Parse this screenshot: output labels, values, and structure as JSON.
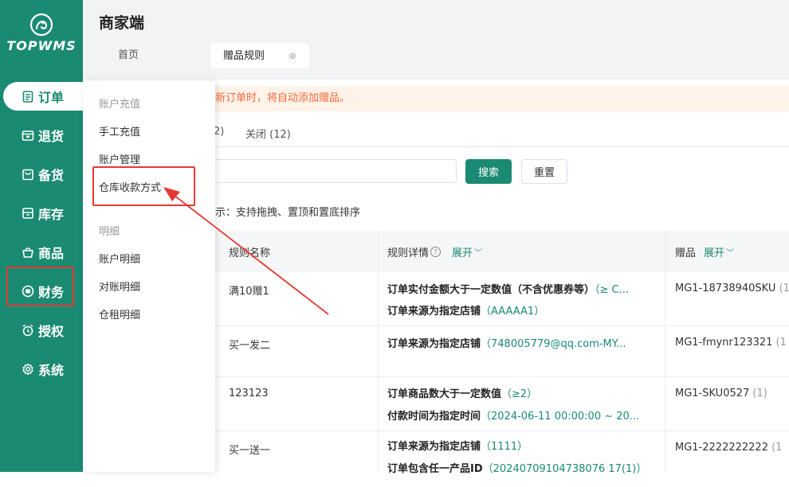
{
  "sidebar": {
    "logo_text": "TOPWMS",
    "items": [
      {
        "label": "订单",
        "icon": "clipboard-icon"
      },
      {
        "label": "退货",
        "icon": "return-box-icon"
      },
      {
        "label": "备货",
        "icon": "shopping-bag-icon"
      },
      {
        "label": "库存",
        "icon": "warehouse-icon"
      },
      {
        "label": "商品",
        "icon": "basket-icon"
      },
      {
        "label": "财务",
        "icon": "money-icon"
      },
      {
        "label": "授权",
        "icon": "alarm-icon"
      },
      {
        "label": "系统",
        "icon": "gear-icon"
      }
    ]
  },
  "header": {
    "brand": "商家端",
    "tabs": [
      {
        "label": "首页"
      },
      {
        "label": "赠品规则",
        "close": "⊗"
      }
    ]
  },
  "notice": "新订单时，将自动添加赠品。",
  "subtabs": {
    "partial": "2)",
    "closed": "关闭 (12)"
  },
  "search": {
    "button": "搜索",
    "reset": "重置"
  },
  "tip": "示：支持拖拽、置顶和置底排序",
  "table": {
    "headers": {
      "name": "规则名称",
      "detail": "规则详情",
      "detail_expand": "展开",
      "gift": "赠品",
      "gift_expand": "展开"
    },
    "rows": [
      {
        "name": "满10赠1",
        "d1_label": "订单实付金额大于一定数值（不含优惠券等）",
        "d1_value": "（≥ C...",
        "d2_label": "订单来源为指定店铺",
        "d2_value": "（AAAAA1）",
        "gift": "MG1-18738940SKU",
        "gift_qty": "(1"
      },
      {
        "name": "买一发二",
        "d1_label": "订单来源为指定店铺",
        "d1_value": "（748005779@qq.com-MY...",
        "d2_label": "",
        "d2_value": "",
        "gift": "MG1-fmynr123321",
        "gift_qty": "(1"
      },
      {
        "name": "123123",
        "d1_label": "订单商品数大于一定数值",
        "d1_value": "（≥2）",
        "d2_label": "付款时间为指定时间",
        "d2_value": "（2024-06-11 00:00:00 ~ 20...",
        "gift": "MG1-SKU0527",
        "gift_qty": "(1)"
      },
      {
        "name": "买一送一",
        "d1_label": "订单来源为指定店铺",
        "d1_value": "（1111）",
        "d2_label": "订单包含任一产品ID",
        "d2_value": "（20240709104738076 17(1)）",
        "gift": "MG1-2222222222",
        "gift_qty": "(1"
      }
    ]
  },
  "dropdown": {
    "group1": "账户充值",
    "items1": [
      "手工充值",
      "账户管理",
      "仓库收款方式"
    ],
    "group2": "明细",
    "items2": [
      "账户明细",
      "对账明细",
      "仓租明细"
    ]
  },
  "colors": {
    "brand": "#1a8a72",
    "highlight": "#e53935",
    "notice_bg": "#fff2e8",
    "notice_text": "#f26b3a"
  }
}
